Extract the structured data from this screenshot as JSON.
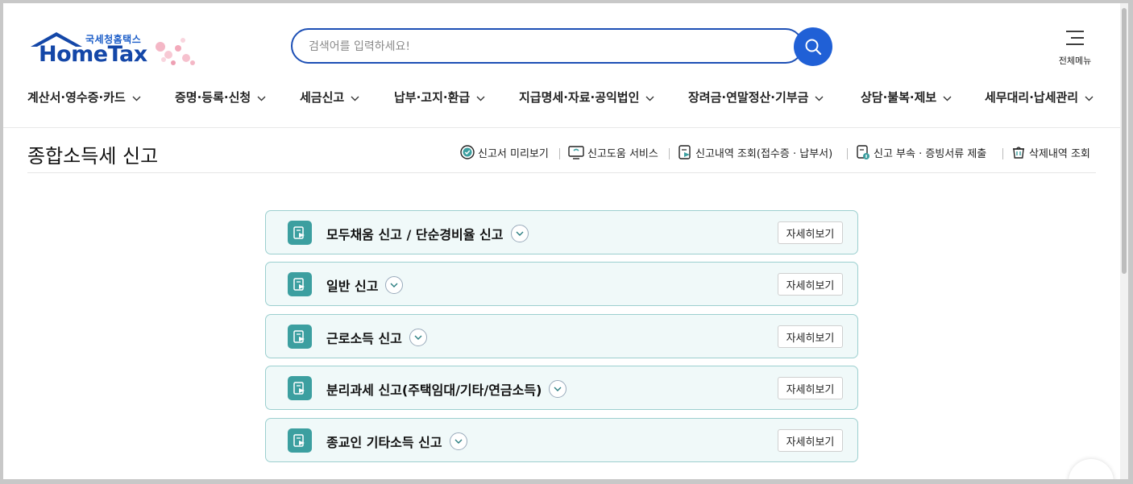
{
  "header": {
    "logo_sub": "국세청홈택스",
    "logo_main": "HomeTax",
    "search_placeholder": "검색어를 입력하세요!",
    "all_menu_label": "전체메뉴",
    "icons": {
      "search": "search-icon",
      "menu": "hamburger-icon"
    },
    "brand_color": "#1c4fb5"
  },
  "nav": [
    "계산서·영수증·카드",
    "증명·등록·신청",
    "세금신고",
    "납부·고지·환급",
    "지급명세·자료·공익법인",
    "장려금·연말정산·기부금",
    "상담·불복·제보",
    "세무대리·납세관리"
  ],
  "page": {
    "title": "종합소득세 신고",
    "quick_links": [
      "신고서 미리보기",
      "신고도움 서비스",
      "신고내역 조회(접수증 · 납부서)",
      "신고 부속 · 증빙서류 제출",
      "삭제내역 조회"
    ]
  },
  "rows": [
    {
      "label": "모두채움 신고 / 단순경비율 신고",
      "button": "자세히보기"
    },
    {
      "label": "일반 신고",
      "button": "자세히보기"
    },
    {
      "label": "근로소득 신고",
      "button": "자세히보기"
    },
    {
      "label": "분리과세 신고(주택임대/기타/연금소득)",
      "button": "자세히보기"
    },
    {
      "label": "종교인 기타소득 신고",
      "button": "자세히보기"
    }
  ],
  "colors": {
    "row_bg": "#f0f9f9",
    "row_border": "#9ccfcf",
    "row_icon": "#3c9fa0"
  }
}
